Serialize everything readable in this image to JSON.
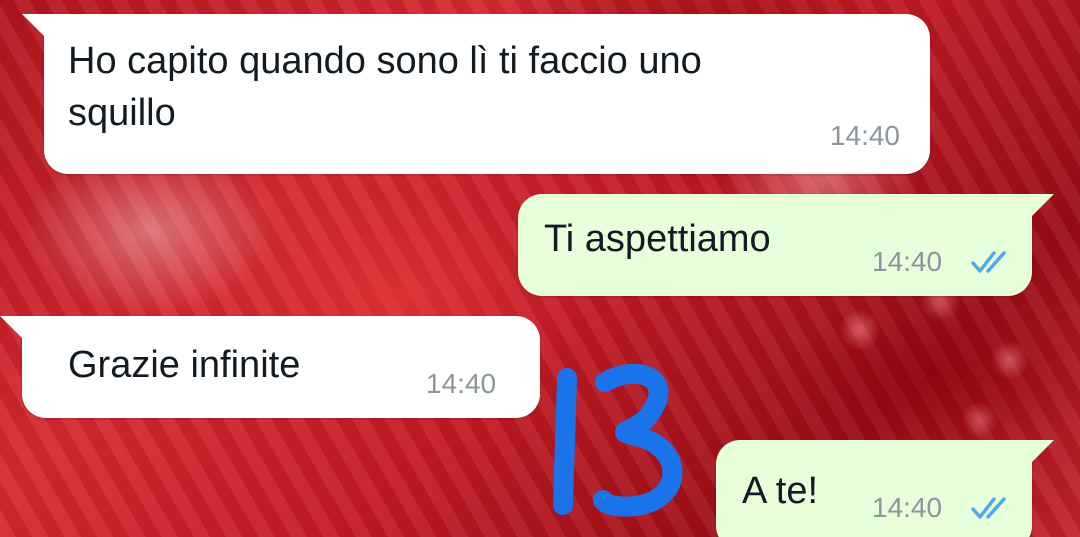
{
  "chat": {
    "messages": [
      {
        "direction": "incoming",
        "lines": [
          "Ho capito quando sono lì ti faccio uno",
          "squillo"
        ],
        "time": "14:40"
      },
      {
        "direction": "outgoing",
        "text": "Ti aspettiamo",
        "time": "14:40",
        "status_icon": "double-check-read-icon"
      },
      {
        "direction": "incoming",
        "text": "Grazie infinite",
        "time": "14:40"
      },
      {
        "direction": "outgoing",
        "text": "A te!",
        "time": "14:40",
        "status_icon": "double-check-read-icon"
      }
    ],
    "annotation": {
      "text": "13",
      "color": "#1a73e8"
    }
  },
  "colors": {
    "incoming_bubble": "#ffffff",
    "outgoing_bubble": "#e7ffdb",
    "read_ticks": "#4fa8e8",
    "timestamp": "#8a959c"
  }
}
